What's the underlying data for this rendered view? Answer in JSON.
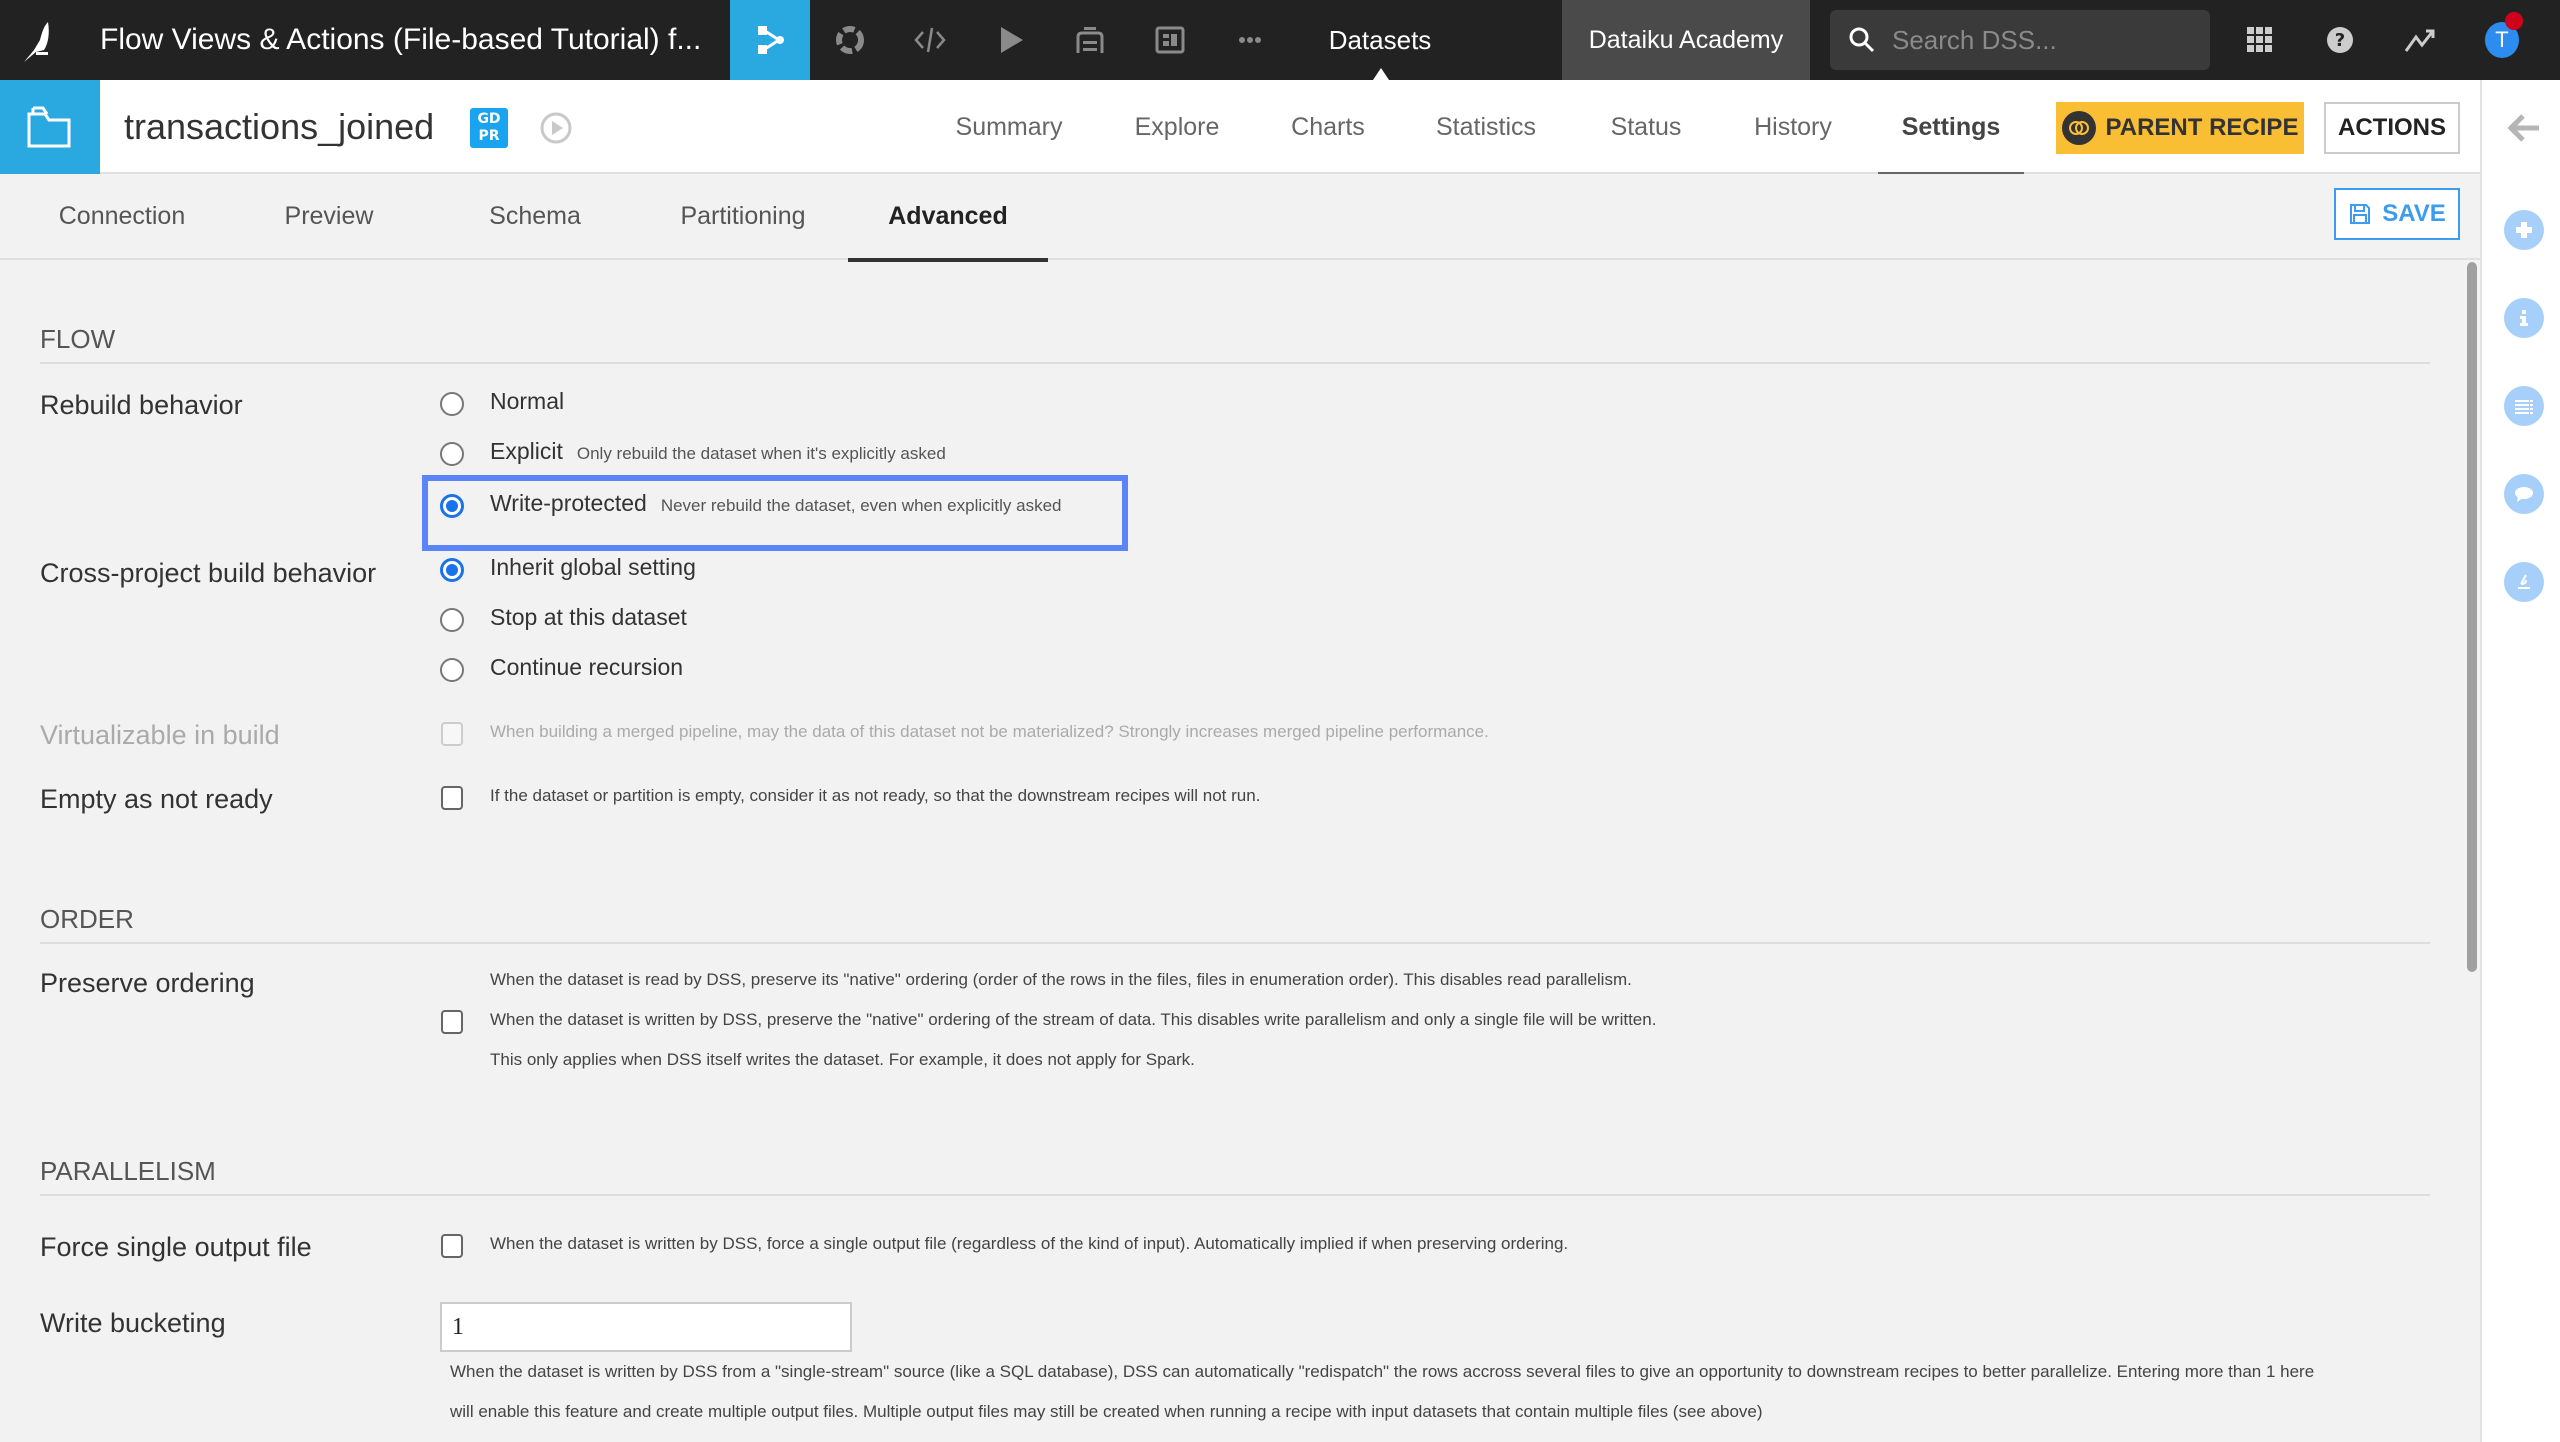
{
  "topbar": {
    "project_title": "Flow Views & Actions (File-based Tutorial) f...",
    "nav_icons": [
      "flow-icon",
      "lab-icon",
      "code-icon",
      "run-icon",
      "deploy-icon",
      "dashboard-icon",
      "more-icon"
    ],
    "datasets_label": "Datasets",
    "academy_label": "Dataiku Academy",
    "search_placeholder": "Search DSS...",
    "avatar_initial": "T"
  },
  "dataset": {
    "name": "transactions_joined",
    "gdpr_badge": "GD\nPR",
    "gdpr_line1": "GD",
    "gdpr_line2": "PR",
    "tabs": [
      {
        "label": "Summary"
      },
      {
        "label": "Explore"
      },
      {
        "label": "Charts"
      },
      {
        "label": "Statistics"
      },
      {
        "label": "Status"
      },
      {
        "label": "History"
      },
      {
        "label": "Settings",
        "active": true
      }
    ],
    "parent_recipe_label": "PARENT RECIPE",
    "actions_label": "ACTIONS"
  },
  "subtabs": {
    "items": [
      {
        "label": "Connection"
      },
      {
        "label": "Preview"
      },
      {
        "label": "Schema"
      },
      {
        "label": "Partitioning"
      },
      {
        "label": "Advanced",
        "active": true
      }
    ],
    "save_label": "SAVE"
  },
  "sections": {
    "flow": {
      "title": "FLOW",
      "rebuild_behavior": {
        "label": "Rebuild behavior",
        "options": [
          {
            "label": "Normal",
            "hint": "",
            "checked": false
          },
          {
            "label": "Explicit",
            "hint": "Only rebuild the dataset when it's explicitly asked",
            "checked": false
          },
          {
            "label": "Write-protected",
            "hint": "Never rebuild the dataset, even when explicitly asked",
            "checked": true
          }
        ]
      },
      "cross_project": {
        "label": "Cross-project build behavior",
        "options": [
          {
            "label": "Inherit global setting",
            "checked": true
          },
          {
            "label": "Stop at this dataset",
            "checked": false
          },
          {
            "label": "Continue recursion",
            "checked": false
          }
        ]
      },
      "virtualizable": {
        "label": "Virtualizable in build",
        "help": "When building a merged pipeline, may the data of this dataset not be materialized? Strongly increases merged pipeline performance.",
        "checked": false,
        "disabled": true
      },
      "empty_not_ready": {
        "label": "Empty as not ready",
        "help": "If the dataset or partition is empty, consider it as not ready, so that the downstream recipes will not run.",
        "checked": false
      }
    },
    "order": {
      "title": "ORDER",
      "preserve_ordering": {
        "label": "Preserve ordering",
        "help_lines": [
          "When the dataset is read by DSS, preserve its \"native\" ordering (order of the rows in the files, files in enumeration order). This disables read parallelism.",
          "When the dataset is written by DSS, preserve the \"native\" ordering of the stream of data. This disables write parallelism and only a single file will be written.",
          "This only applies when DSS itself writes the dataset. For example, it does not apply for Spark."
        ],
        "checked": false
      }
    },
    "parallelism": {
      "title": "PARALLELISM",
      "force_single": {
        "label": "Force single output file",
        "help": "When the dataset is written by DSS, force a single output file (regardless of the kind of input). Automatically implied if when preserving ordering.",
        "checked": false
      },
      "write_bucketing": {
        "label": "Write bucketing",
        "value": "1",
        "help_lines": [
          "When the dataset is written by DSS from a \"single-stream\" source (like a SQL database), DSS can automatically \"redispatch\" the rows accross several files to give an opportunity to downstream recipes to better parallelize. Entering more than 1 here",
          "will enable this feature and create multiple output files. Multiple output files may still be created when running a recipe with input datasets that contain multiple files (see above)"
        ]
      }
    }
  },
  "right_sidebar": {
    "icons": [
      "back-arrow-icon",
      "add-icon",
      "info-icon",
      "list-icon",
      "comment-icon",
      "lab-icon"
    ]
  },
  "colors": {
    "brand_blue": "#29a9e0",
    "topbar_bg": "#222222",
    "parent_recipe_bg": "#f9be34",
    "highlight_border": "#5b84f8",
    "radio_checked": "#1a73e8",
    "save_blue": "#3d9bf0"
  }
}
